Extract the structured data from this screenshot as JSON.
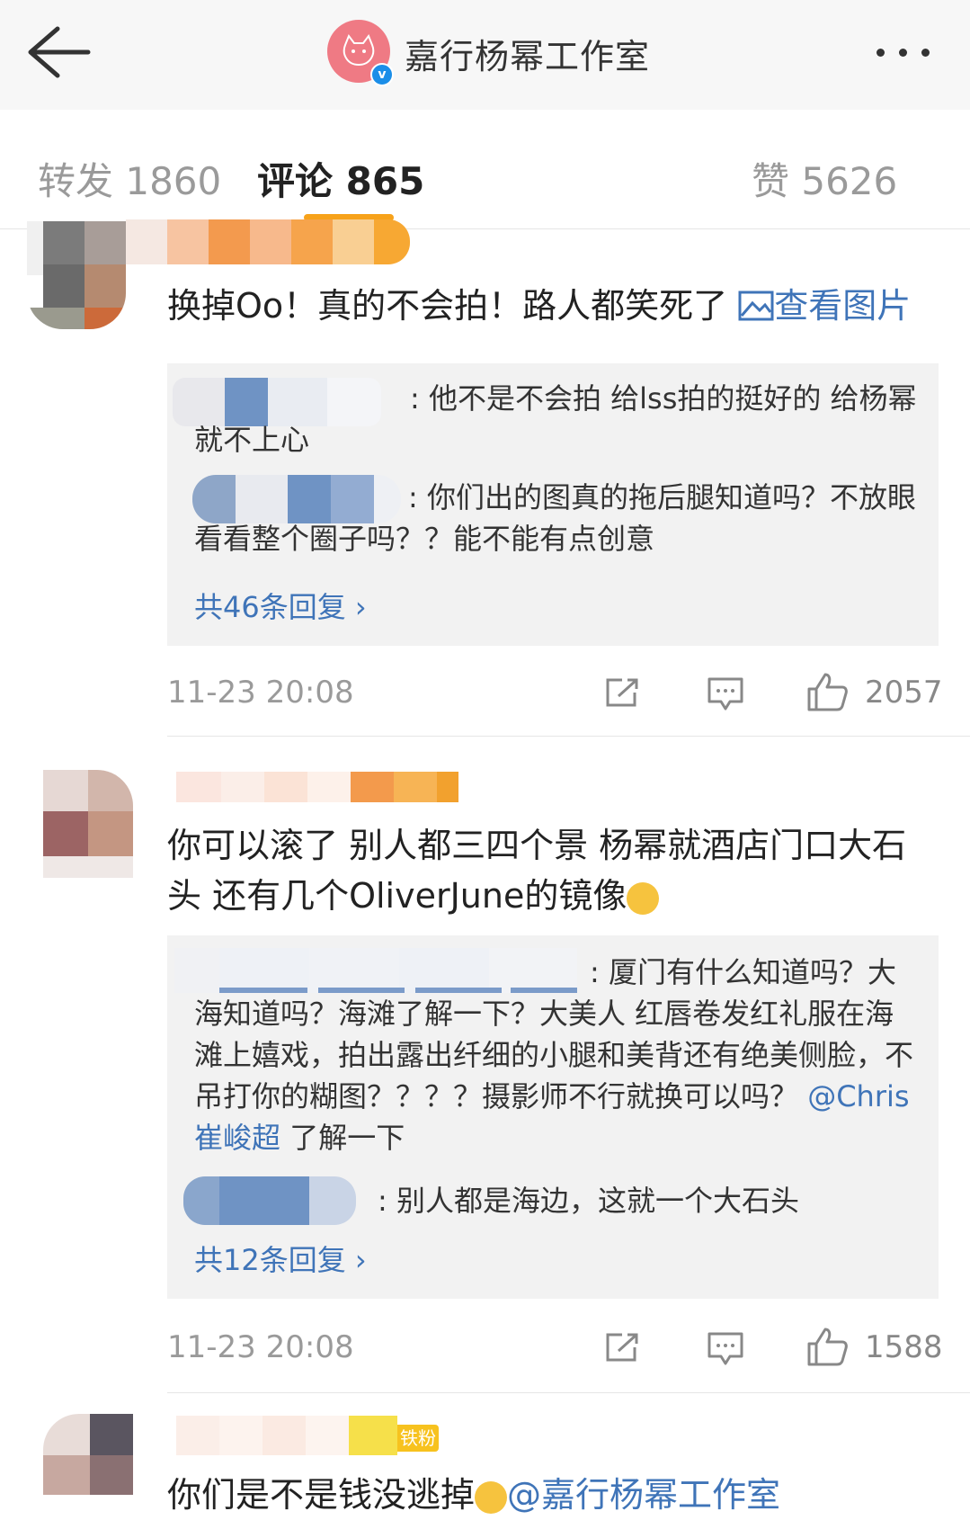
{
  "header": {
    "title": "嘉行杨幂工作室",
    "verified_icon": "v",
    "back_icon": "arrow-left-icon",
    "more_icon": "more-dots-icon"
  },
  "tabs": [
    {
      "label": "转发 1860"
    },
    {
      "label": "评论 865"
    },
    {
      "label": "赞 5626"
    }
  ],
  "comments": [
    {
      "text": "换掉Oo！真的不会拍！路人都笑死了",
      "view_image": "查看图片",
      "replies": [
        {
          "text": ": 他不是不会拍 给lss拍的挺好的 给杨幂就不上心"
        },
        {
          "text": ": 你们出的图真的拖后腿知道吗？不放眼看看整个圈子吗？？能不能有点创意"
        }
      ],
      "more_replies": "共46条回复",
      "time": "11-23 20:08",
      "likes": "2057"
    },
    {
      "text": "你可以滚了 别人都三四个景 杨幂就酒店门口大石头 还有几个OliverJune的镜像",
      "replies": [
        {
          "text": ": 厦门有什么知道吗？大海知道吗？海滩了解一下？大美人 红唇卷发红礼服在海滩上嬉戏，拍出露出纤细的小腿和美背还有绝美侧脸，不吊打你的糊图？？？？摄影师不行就换可以吗？",
          "mention": "@Chris崔峻超",
          "tail": "了解一下"
        },
        {
          "text": ": 别人都是海边，这就一个大石头"
        }
      ],
      "more_replies": "共12条回复",
      "time": "11-23 20:08",
      "likes": "1588"
    },
    {
      "badge": "铁粉",
      "text": "你们是不是钱没逃掉",
      "mention": "@嘉行杨幂工作室"
    }
  ],
  "colors": {
    "accent": "#f7a21a",
    "link": "#3f74b8",
    "reply_bg": "#f2f2f2"
  }
}
